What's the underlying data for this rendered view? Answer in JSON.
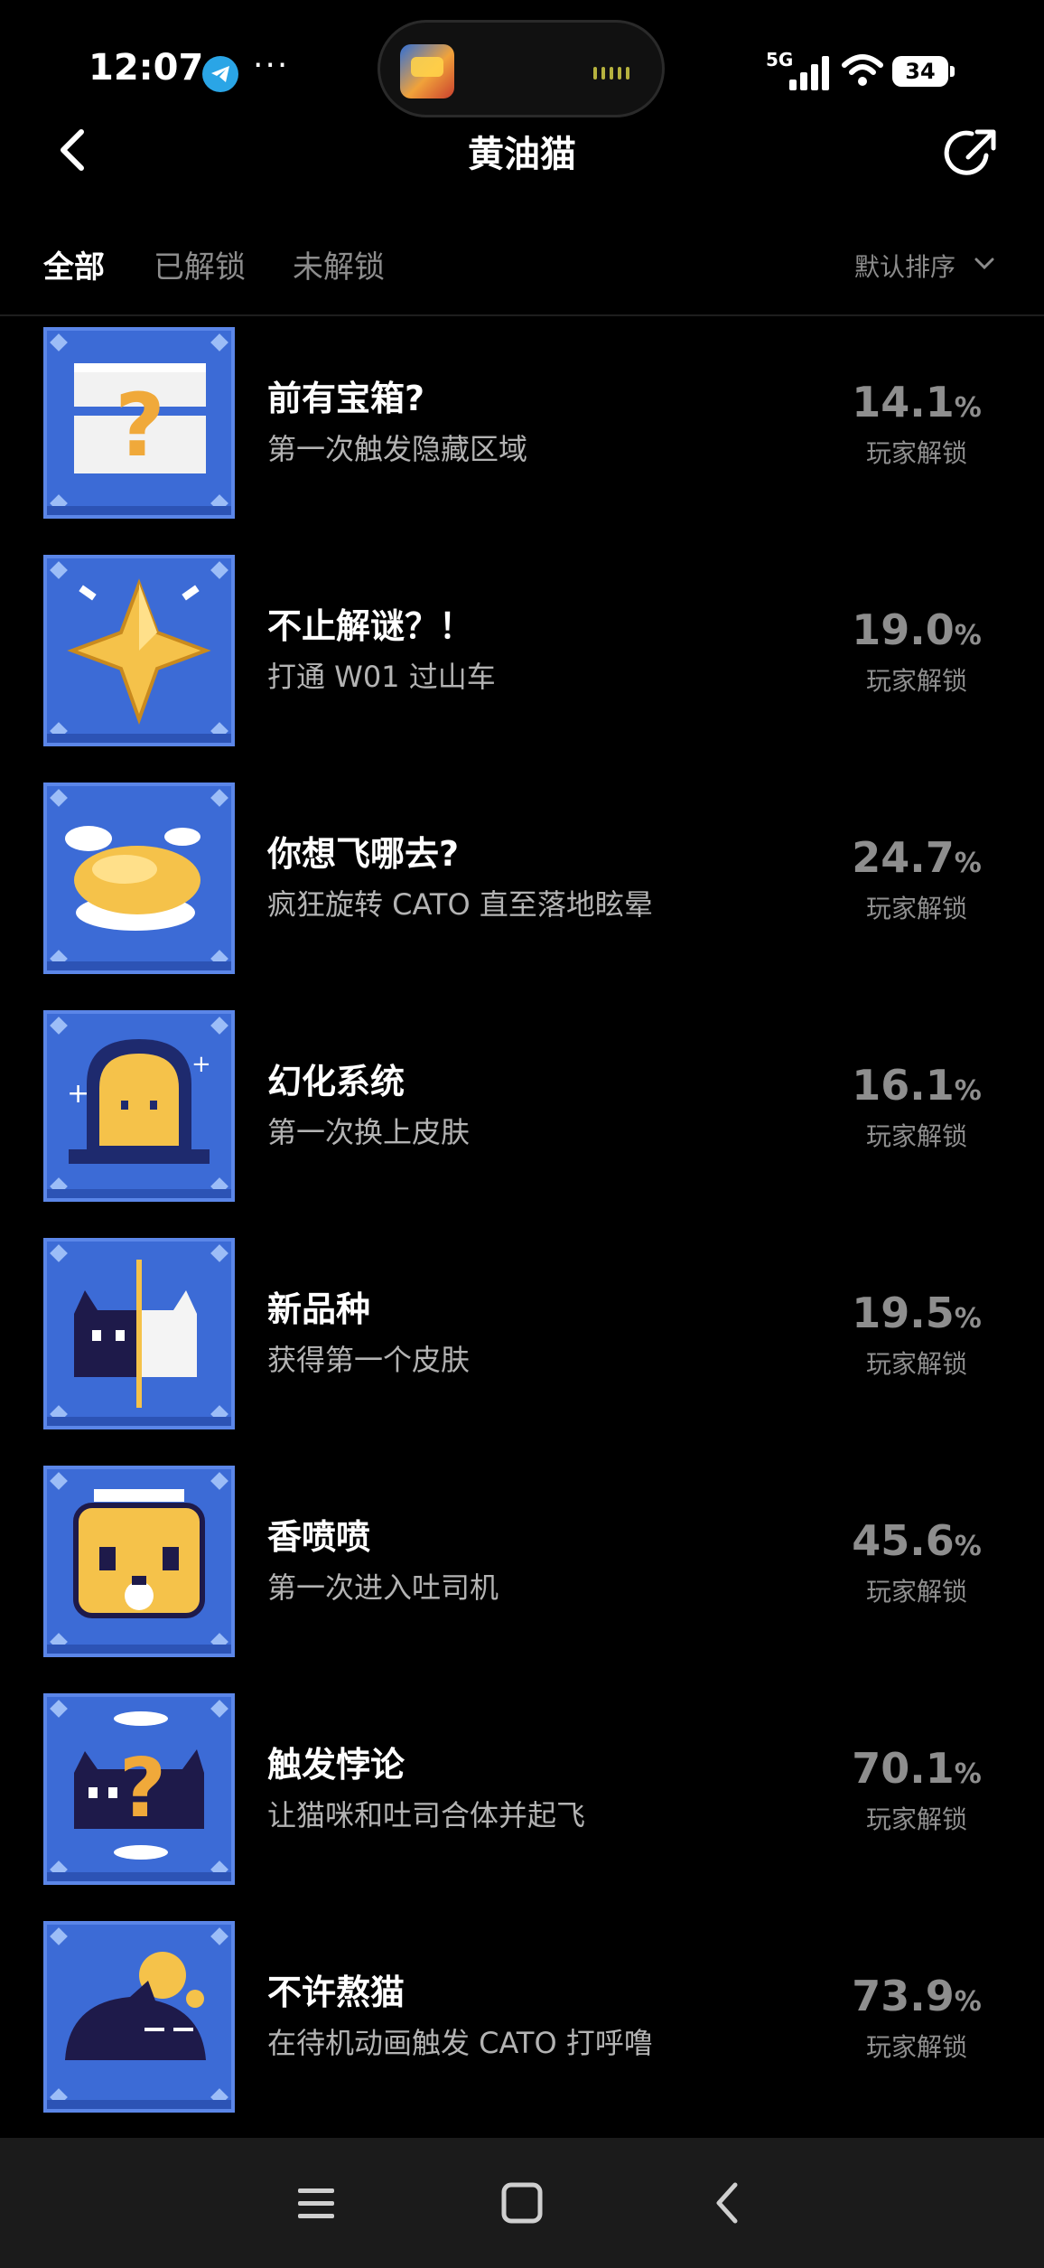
{
  "status_bar": {
    "time": "12:07",
    "more": "···",
    "network": "5G",
    "battery": "34",
    "accent_color": "#2aa5e6"
  },
  "header": {
    "title": "黄油猫",
    "back_icon": "chevron-left-icon",
    "share_icon": "share-icon"
  },
  "tabs": [
    {
      "label": "全部",
      "active": true
    },
    {
      "label": "已解锁",
      "active": false
    },
    {
      "label": "未解锁",
      "active": false
    }
  ],
  "sort": {
    "label": "默认排序"
  },
  "achievements": [
    {
      "icon": "treasure-chest-icon",
      "title": "前有宝箱?",
      "desc": "第一次触发隐藏区域",
      "percent": "14.1",
      "unit": "%",
      "sub": "玩家解锁"
    },
    {
      "icon": "star-icon",
      "title": "不止解谜？！",
      "desc": "打通 W01 过山车",
      "percent": "19.0",
      "unit": "%",
      "sub": "玩家解锁"
    },
    {
      "icon": "cloud-toast-icon",
      "title": "你想飞哪去?",
      "desc": "疯狂旋转 CATO 直至落地眩晕",
      "percent": "24.7",
      "unit": "%",
      "sub": "玩家解锁"
    },
    {
      "icon": "cat-portal-icon",
      "title": "幻化系统",
      "desc": "第一次换上皮肤",
      "percent": "16.1",
      "unit": "%",
      "sub": "玩家解锁"
    },
    {
      "icon": "split-cat-icon",
      "title": "新品种",
      "desc": "获得第一个皮肤",
      "percent": "19.5",
      "unit": "%",
      "sub": "玩家解锁"
    },
    {
      "icon": "toast-face-icon",
      "title": "香喷喷",
      "desc": "第一次进入吐司机",
      "percent": "45.6",
      "unit": "%",
      "sub": "玩家解锁"
    },
    {
      "icon": "paradox-cat-icon",
      "title": "触发悖论",
      "desc": "让猫咪和吐司合体并起飞",
      "percent": "70.1",
      "unit": "%",
      "sub": "玩家解锁"
    },
    {
      "icon": "sleeping-cat-icon",
      "title": "不许熬猫",
      "desc": "在待机动画触发 CATO 打呼噜",
      "percent": "73.9",
      "unit": "%",
      "sub": "玩家解锁"
    }
  ],
  "nav": {
    "menu_icon": "menu-icon",
    "home_icon": "home-square-icon",
    "back_icon": "back-chevron-icon"
  }
}
